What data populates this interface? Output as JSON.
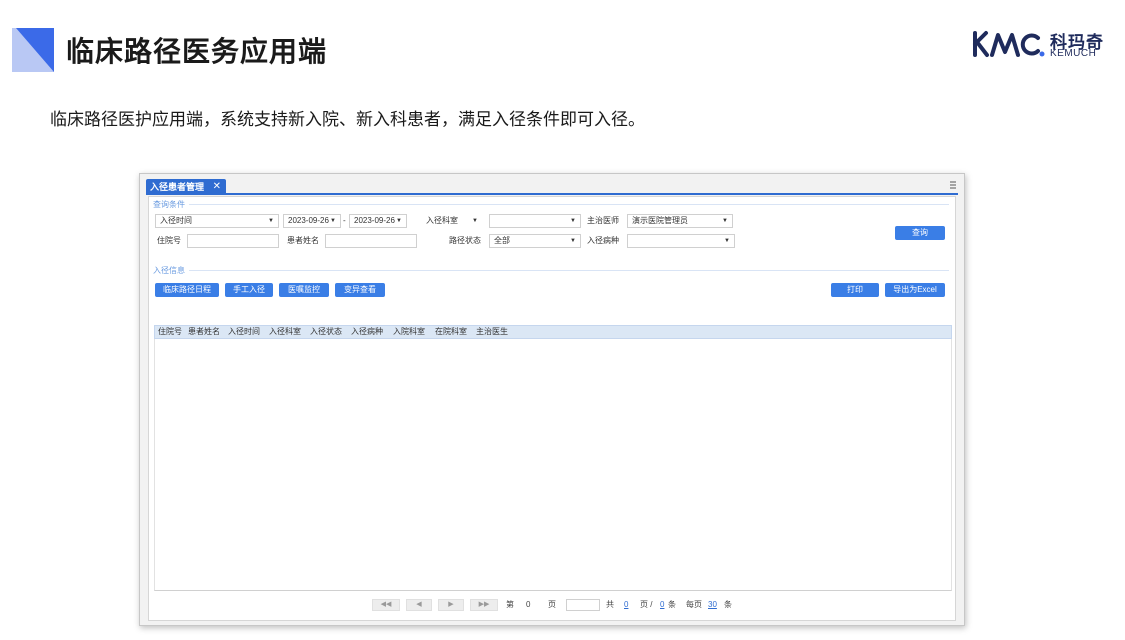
{
  "slide": {
    "title": "临床路径医务应用端",
    "subtitle": "临床路径医护应用端，系统支持新入院、新入科患者，满足入径条件即可入径。",
    "logo": {
      "cn": "科玛奇",
      "en": "KEMUCH"
    },
    "accent_color": "#3b6ae8"
  },
  "app": {
    "tab": {
      "label": "入径患者管理",
      "close": "✕"
    },
    "query_section": "查询条件",
    "query": {
      "entry_time_select": "入径时间",
      "date_from": "2023-09-26",
      "date_sep": "-",
      "date_to": "2023-09-26",
      "dept_select": "入径科室",
      "dept_value": "",
      "doctor_label": "主治医师",
      "doctor_value": "演示医院管理员",
      "inpatient_no_label": "住院号",
      "patient_name_label": "患者姓名",
      "path_status_label": "路径状态",
      "path_status_value": "全部",
      "disease_label": "入径病种",
      "disease_value": "",
      "search_btn": "查询"
    },
    "info_section": "入径信息",
    "actions": [
      "临床路径日程",
      "手工入径",
      "医嘱监控",
      "变异查看"
    ],
    "right_actions": [
      "打印",
      "导出为Excel"
    ],
    "columns": [
      "住院号",
      "患者姓名",
      "入径时间",
      "入径科室",
      "入径状态",
      "入径病种",
      "入院科室",
      "在院科室",
      "主治医生"
    ],
    "pager": {
      "first": "◀◀",
      "prev": "◀",
      "next": "▶",
      "last": "▶▶",
      "page_label": "第",
      "page_value": "0",
      "page_unit": "页",
      "total_label": "共",
      "total_pages": "0",
      "total_unit": "页 /",
      "records": "0",
      "records_unit": "条",
      "per_page_label": "每页",
      "per_page": "30",
      "per_page_unit": "条"
    }
  }
}
